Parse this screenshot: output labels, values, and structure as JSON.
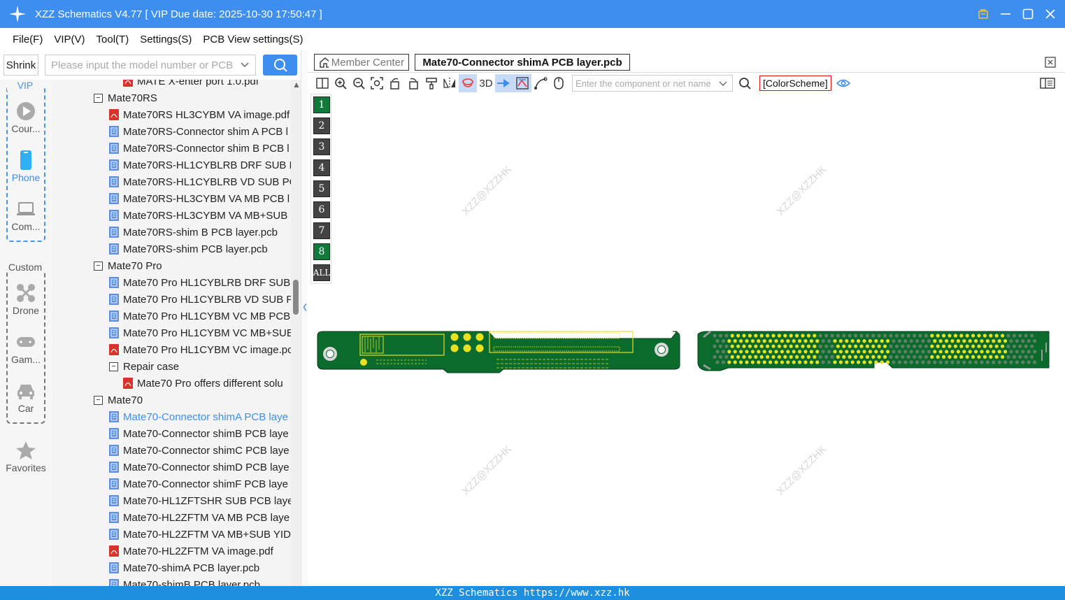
{
  "titlebar": {
    "title": "XZZ Schematics V4.77 [ VIP Due date: 2025-10-30 17:50:47 ]"
  },
  "menu": {
    "items": [
      "File(F)",
      "VIP(V)",
      "Tool(T)",
      "Settings(S)",
      "PCB View settings(S)"
    ]
  },
  "sidebar": {
    "shrink_label": "Shrink",
    "search_placeholder": "Please input the model number or PCB",
    "vip_label": "VIP",
    "custom_label": "Custom",
    "vip_items": [
      "Cour...",
      "Phone",
      "Com..."
    ],
    "custom_items": [
      "Drone",
      "Gam...",
      "Car"
    ],
    "favorites_label": "Favorites"
  },
  "tree": {
    "rows": [
      {
        "text": "MATE X-enter port 1.0.pdf",
        "type": "pdf",
        "indent": 3
      },
      {
        "text": "Mate70RS",
        "type": "folder",
        "indent": 1
      },
      {
        "text": "Mate70RS HL3CYBM VA image.pdf",
        "type": "pdf",
        "indent": 2
      },
      {
        "text": "Mate70RS-Connector shim A PCB l",
        "type": "pcb",
        "indent": 2
      },
      {
        "text": "Mate70RS-Connector shim B PCB l",
        "type": "pcb",
        "indent": 2
      },
      {
        "text": "Mate70RS-HL1CYBLRB DRF SUB PC",
        "type": "pcb",
        "indent": 2
      },
      {
        "text": "Mate70RS-HL1CYBLRB VD SUB PCI",
        "type": "pcb",
        "indent": 2
      },
      {
        "text": "Mate70RS-HL3CYBM VA MB PCB l",
        "type": "pcb",
        "indent": 2
      },
      {
        "text": "Mate70RS-HL3CYBM VA MB+SUB",
        "type": "pcb",
        "indent": 2
      },
      {
        "text": "Mate70RS-shim B PCB layer.pcb",
        "type": "pcb",
        "indent": 2
      },
      {
        "text": "Mate70RS-shim PCB layer.pcb",
        "type": "pcb",
        "indent": 2
      },
      {
        "text": "Mate70 Pro",
        "type": "folder",
        "indent": 1
      },
      {
        "text": "Mate70 Pro HL1CYBLRB DRF SUB F",
        "type": "pcb",
        "indent": 2
      },
      {
        "text": "Mate70 Pro HL1CYBLRB VD SUB PC",
        "type": "pcb",
        "indent": 2
      },
      {
        "text": "Mate70 Pro HL1CYBM VC MB PCB",
        "type": "pcb",
        "indent": 2
      },
      {
        "text": "Mate70 Pro HL1CYBM VC MB+SUE",
        "type": "pcb",
        "indent": 2
      },
      {
        "text": "Mate70 Pro HL1CYBM VC image.pc",
        "type": "pdf",
        "indent": 2
      },
      {
        "text": "Repair case",
        "type": "folder",
        "indent": 2
      },
      {
        "text": "Mate70 Pro offers different solu",
        "type": "pdf",
        "indent": 3
      },
      {
        "text": "Mate70",
        "type": "folder",
        "indent": 1
      },
      {
        "text": "Mate70-Connector shimA PCB laye",
        "type": "pcb",
        "indent": 2,
        "selected": true
      },
      {
        "text": "Mate70-Connector shimB PCB laye",
        "type": "pcb",
        "indent": 2
      },
      {
        "text": "Mate70-Connector shimC PCB laye",
        "type": "pcb",
        "indent": 2
      },
      {
        "text": "Mate70-Connector shimD PCB laye",
        "type": "pcb",
        "indent": 2
      },
      {
        "text": "Mate70-Connector shimF PCB laye",
        "type": "pcb",
        "indent": 2
      },
      {
        "text": "Mate70-HL1ZFTSHR SUB PCB layer",
        "type": "pcb",
        "indent": 2
      },
      {
        "text": "Mate70-HL2ZFTM VA MB PCB laye",
        "type": "pcb",
        "indent": 2
      },
      {
        "text": "Mate70-HL2ZFTM VA MB+SUB YID",
        "type": "pcb",
        "indent": 2
      },
      {
        "text": "Mate70-HL2ZFTM VA image.pdf",
        "type": "pdf",
        "indent": 2
      },
      {
        "text": "Mate70-shimA PCB layer.pcb",
        "type": "pcb",
        "indent": 2
      },
      {
        "text": "Mate70-shimB PCB layer.pcb",
        "type": "pcb",
        "indent": 2
      }
    ]
  },
  "tabs": {
    "member": "Member Center",
    "active": "Mate70-Connector shimA PCB layer.pcb"
  },
  "toolbar": {
    "label_3d": "3D",
    "component_placeholder": "Enter the component or net name",
    "colorscheme": "[ColorScheme]"
  },
  "layers": [
    "1",
    "2",
    "3",
    "4",
    "5",
    "6",
    "7",
    "8",
    "ALL"
  ],
  "watermark": "XZZ@XZZHK",
  "footer": {
    "text": "XZZ Schematics https://www.xzz.hk"
  },
  "colors": {
    "accent": "#3e8ef0",
    "pcb_green": "#0a6b2c",
    "pad_yellow": "#e8e020",
    "footer": "#1e8fdf"
  }
}
